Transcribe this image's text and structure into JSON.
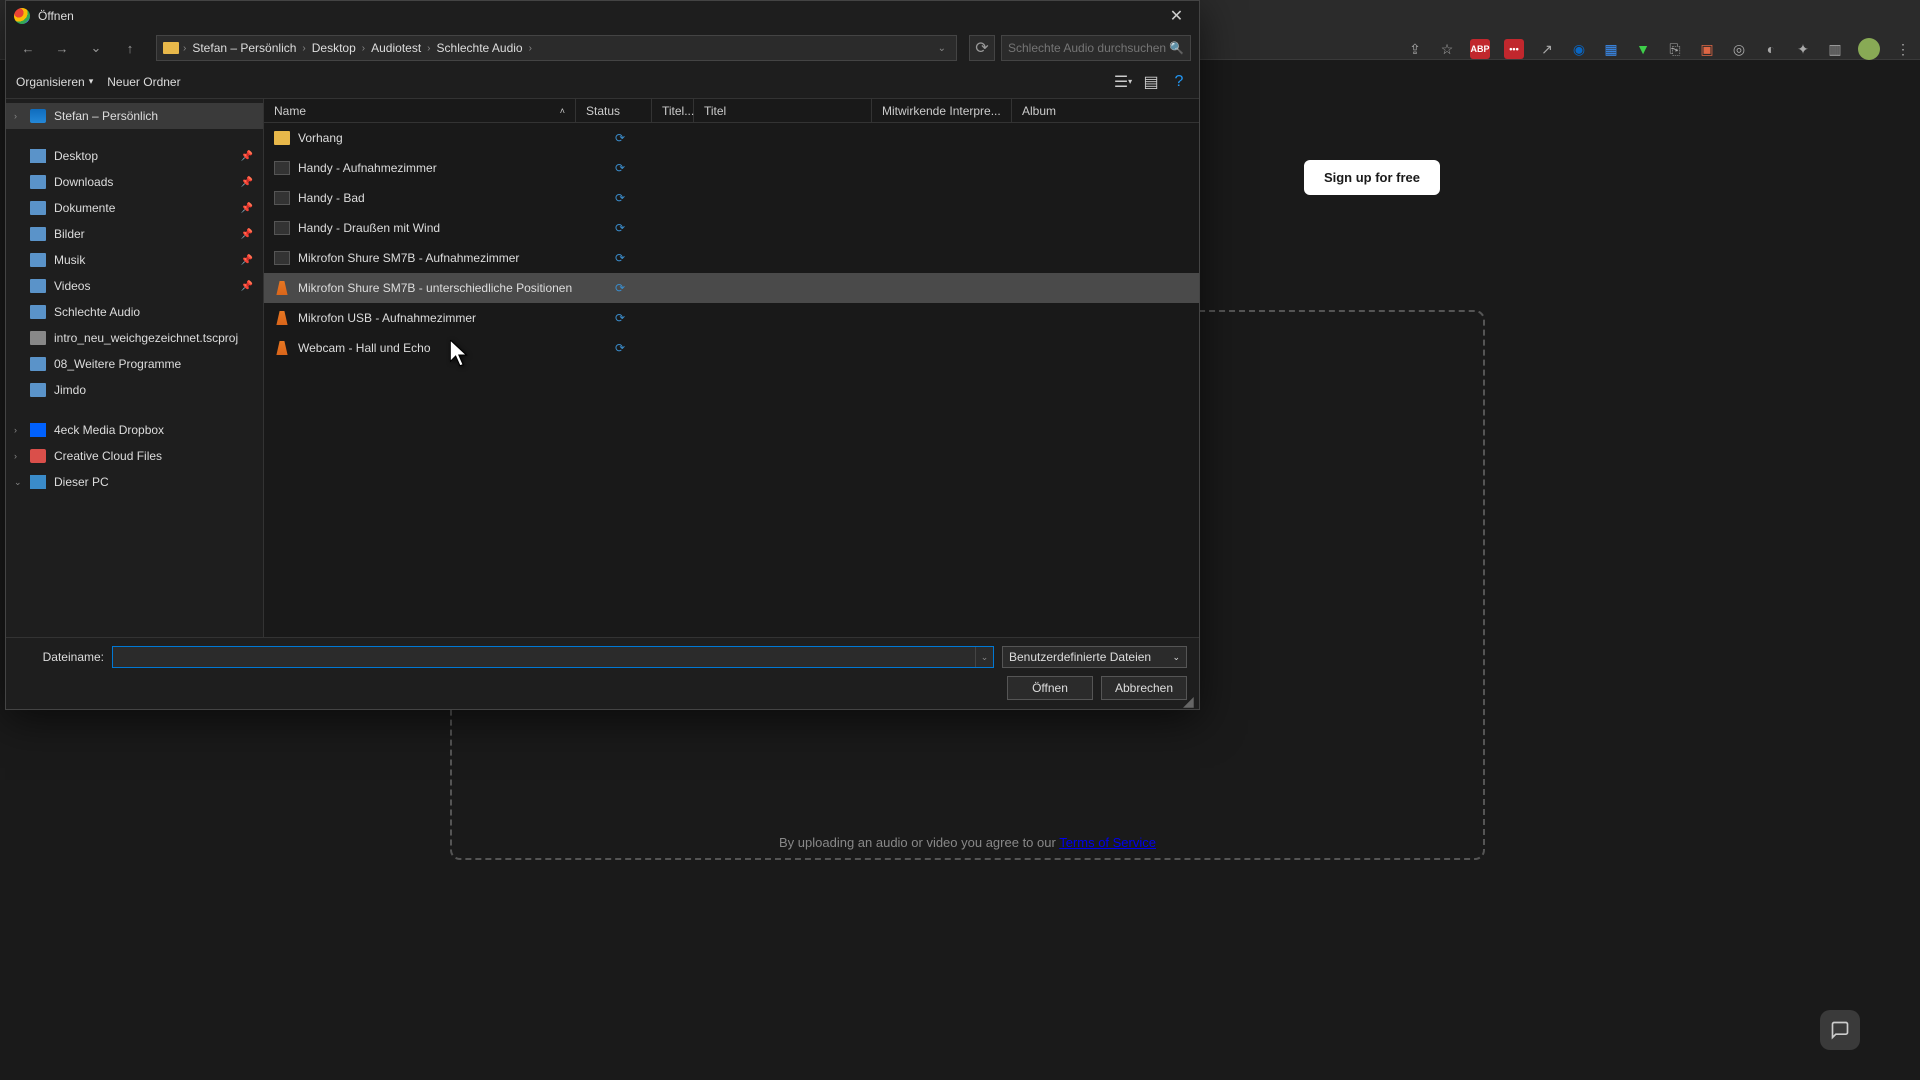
{
  "browser": {
    "win_min": "—",
    "win_max": "▢",
    "win_close": "✕",
    "signup_label": "Sign up for free",
    "terms_prefix": "By uploading an audio or video you agree to our ",
    "terms_link": "Terms of Service"
  },
  "dialog": {
    "title": "Öffnen",
    "close": "✕",
    "nav": {
      "back": "←",
      "forward": "→",
      "recent": "⌄",
      "up": "↑",
      "refresh": "⟳"
    },
    "breadcrumb": [
      "Stefan – Persönlich",
      "Desktop",
      "Audiotest",
      "Schlechte Audio"
    ],
    "bc_sep": "›",
    "search_placeholder": "Schlechte Audio durchsuchen",
    "toolbar": {
      "organize": "Organisieren",
      "new_folder": "Neuer Ordner"
    },
    "sidebar": {
      "items": [
        {
          "label": "Stefan – Persönlich",
          "icon": "onedrive",
          "active": true,
          "expander": "›"
        },
        {
          "sep": true
        },
        {
          "label": "Desktop",
          "icon": "desktop",
          "pinned": true
        },
        {
          "label": "Downloads",
          "icon": "folder",
          "pinned": true
        },
        {
          "label": "Dokumente",
          "icon": "folder",
          "pinned": true
        },
        {
          "label": "Bilder",
          "icon": "folder",
          "pinned": true
        },
        {
          "label": "Musik",
          "icon": "folder",
          "pinned": true
        },
        {
          "label": "Videos",
          "icon": "folder",
          "pinned": true
        },
        {
          "label": "Schlechte Audio",
          "icon": "folder"
        },
        {
          "label": "intro_neu_weichgezeichnet.tscproj",
          "icon": "file"
        },
        {
          "label": "08_Weitere Programme",
          "icon": "folder"
        },
        {
          "label": "Jimdo",
          "icon": "folder"
        },
        {
          "sep": true
        },
        {
          "label": "4eck Media Dropbox",
          "icon": "dropbox",
          "expander": "›"
        },
        {
          "label": "Creative Cloud Files",
          "icon": "cc",
          "expander": "›"
        },
        {
          "label": "Dieser PC",
          "icon": "pc",
          "expander": "⌄"
        }
      ]
    },
    "columns": {
      "name": "Name",
      "status": "Status",
      "titelno": "Titel...",
      "titel": "Titel",
      "interp": "Mitwirkende Interpre...",
      "album": "Album",
      "sort": "˄"
    },
    "files": [
      {
        "name": "Vorhang",
        "icon": "folder",
        "sync": true
      },
      {
        "name": "Handy - Aufnahmezimmer",
        "icon": "audio",
        "sync": true
      },
      {
        "name": "Handy - Bad",
        "icon": "audio",
        "sync": true
      },
      {
        "name": "Handy - Draußen mit Wind",
        "icon": "audio",
        "sync": true
      },
      {
        "name": "Mikrofon Shure SM7B - Aufnahmezimmer",
        "icon": "audio",
        "sync": true
      },
      {
        "name": "Mikrofon Shure SM7B - unterschiedliche Positionen",
        "icon": "vlc",
        "sync": true,
        "selected": true
      },
      {
        "name": "Mikrofon USB - Aufnahmezimmer",
        "icon": "vlc",
        "sync": true
      },
      {
        "name": "Webcam - Hall und Echo",
        "icon": "vlc",
        "sync": true
      }
    ],
    "bottom": {
      "filename_label": "Dateiname:",
      "filename_value": "",
      "filetype": "Benutzerdefinierte Dateien",
      "open": "Öffnen",
      "cancel": "Abbrechen"
    }
  }
}
